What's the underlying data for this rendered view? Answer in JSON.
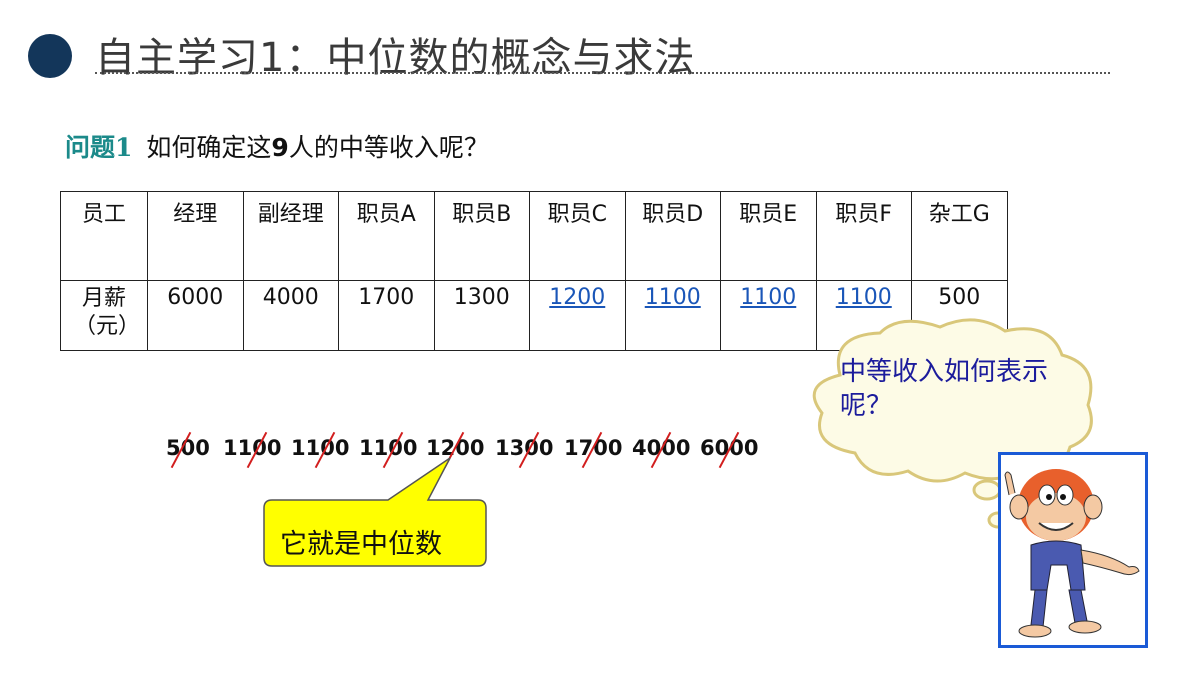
{
  "header": {
    "title": "自主学习1：中位数的概念与求法"
  },
  "question": {
    "label": "问题1",
    "text_before": "如何确定这",
    "number": "9",
    "text_after": "人的中等收入呢？"
  },
  "table": {
    "row_header_1": "员工",
    "row_header_2": "月薪（元）",
    "columns": [
      "经理",
      "副经理",
      "职员A",
      "职员B",
      "职员C",
      "职员D",
      "职员E",
      "职员F",
      "杂工G"
    ],
    "salaries": [
      "6000",
      "4000",
      "1700",
      "1300",
      "1200",
      "1100",
      "1100",
      "1100",
      "500"
    ]
  },
  "sorted_numbers": [
    "500",
    "1100",
    "1100",
    "1100",
    "1200",
    "1300",
    "1700",
    "4000",
    "6000"
  ],
  "callout": {
    "text": "它就是中位数",
    "color": "#ffff00"
  },
  "thought_bubble": {
    "text": "中等收入如何表示呢？",
    "fill": "#fdfbe6",
    "border": "#d9c77a"
  },
  "colors": {
    "accent_dot": "#13365a",
    "question_label": "#1b8a8a",
    "link": "#1a56b8",
    "strike": "#d21e1e"
  },
  "mascot": {
    "icon": "cartoon-monkey-icon"
  }
}
